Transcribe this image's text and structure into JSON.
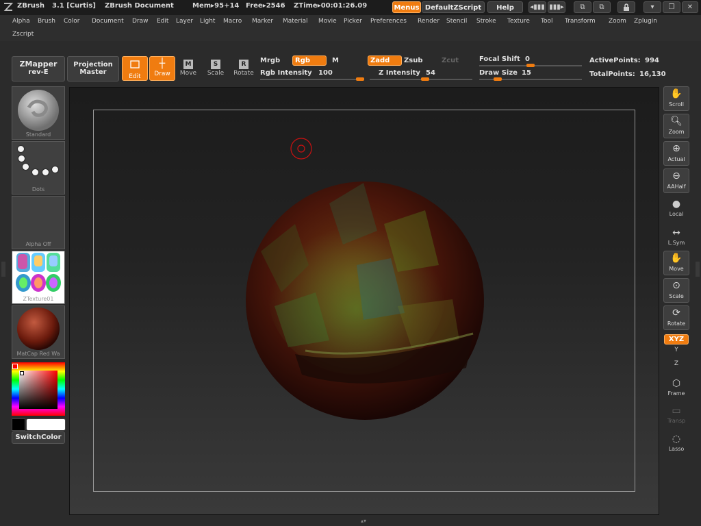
{
  "titlebar": {
    "app": "ZBrush",
    "version": "3.1 [Curtis]",
    "document": "ZBrush Document",
    "mem": "Mem▸95+14",
    "free": "Free▸2546",
    "ztime": "ZTime▸00:01:26.09",
    "menus_btn": "Menus",
    "script_btn": "DefaultZScript",
    "help_btn": "Help"
  },
  "menubar": {
    "row1": [
      "Alpha",
      "Brush",
      "Color",
      "Document",
      "Draw",
      "Edit",
      "Layer",
      "Light",
      "Macro",
      "Marker",
      "Material",
      "Movie",
      "Picker",
      "Preferences",
      "Render",
      "Stencil",
      "Stroke",
      "Texture",
      "Tool",
      "Transform",
      "Zoom",
      "Zplugin"
    ],
    "row2": [
      "Zscript"
    ]
  },
  "shelf": {
    "zmapper_line1": "ZMapper",
    "zmapper_line2": "rev-E",
    "projection_line1": "Projection",
    "projection_line2": "Master",
    "edit": "Edit",
    "draw": "Draw",
    "move": "Move",
    "scale": "Scale",
    "rotate": "Rotate",
    "mrgb": "Mrgb",
    "rgb": "Rgb",
    "m": "M",
    "zadd": "Zadd",
    "zsub": "Zsub",
    "zcut": "Zcut",
    "rgb_intensity_label": "Rgb Intensity",
    "rgb_intensity_value": "100",
    "z_intensity_label": "Z Intensity",
    "z_intensity_value": "54",
    "focal_shift_label": "Focal Shift",
    "focal_shift_value": "0",
    "draw_size_label": "Draw Size",
    "draw_size_value": "15",
    "active_points_label": "ActivePoints:",
    "active_points_value": "994",
    "total_points_label": "TotalPoints:",
    "total_points_value": "16,130",
    "rgb_intensity_level": 1.0,
    "z_intensity_level": 0.54,
    "focal_shift_level": 0.5,
    "draw_size_level": 0.15
  },
  "left_tray": {
    "brush": "Standard",
    "stroke": "Dots",
    "alpha": "Alpha Off",
    "texture": "ZTexture01",
    "material": "MatCap Red Wa",
    "switch_color": "SwitchColor"
  },
  "right_tray": {
    "scroll": "Scroll",
    "zoom": "Zoom",
    "actual": "Actual",
    "aahalf": "AAHalf",
    "local": "Local",
    "lsym": "L.Sym",
    "move": "Move",
    "scale": "Scale",
    "rotate": "Rotate",
    "xyz": "XYZ",
    "y": "Y",
    "z": "Z",
    "frame": "Frame",
    "transp": "Transp",
    "lasso": "Lasso"
  },
  "colors": {
    "accent": "#f07c10",
    "background": "#2b2b2b",
    "canvas_top": "#1c1c1c",
    "canvas_bottom": "#3a3a3a",
    "sphere": "#5a1a0c",
    "brush_cursor": "#cc1111",
    "foreground_swatch": "#000000",
    "background_swatch": "#ffffff"
  },
  "icons": {
    "logo": "zbrush-logo-icon",
    "lock": "lock-icon",
    "minimize": "minimize-icon",
    "restore": "restore-icon",
    "close": "close-icon"
  }
}
